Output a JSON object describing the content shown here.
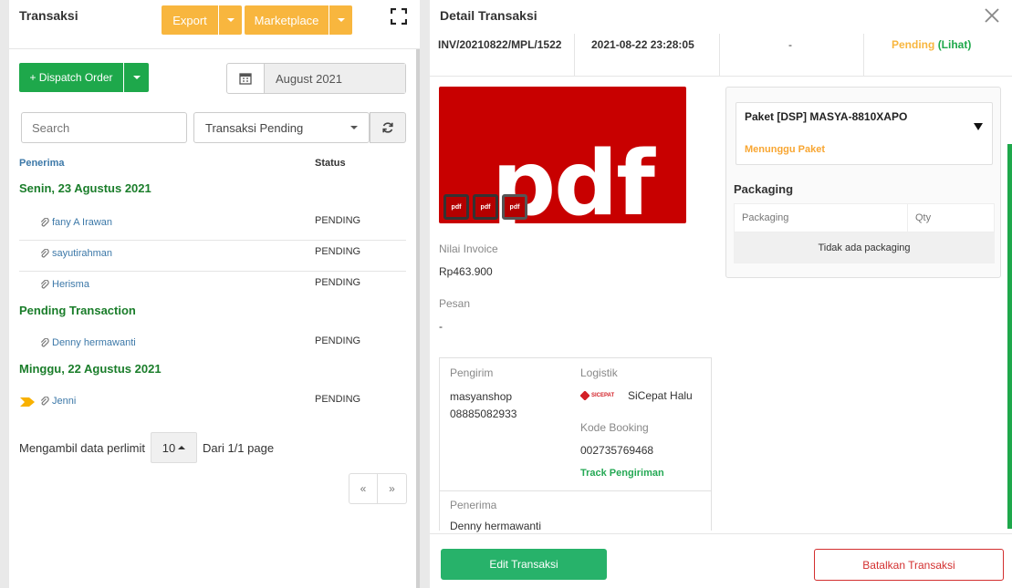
{
  "left": {
    "title": "Transaksi",
    "export_label": "Export",
    "marketplace_label": "Marketplace",
    "dispatch_label": "+ Dispatch Order",
    "month": "August 2021",
    "search_placeholder": "Search",
    "filter_selected": "Transaksi Pending",
    "col_receiver": "Penerima",
    "col_status": "Status",
    "groups": [
      {
        "title": "Senin, 23 Agustus 2021",
        "rows": [
          {
            "name": "fany A Irawan",
            "status": "PENDING"
          },
          {
            "name": "sayutirahman",
            "status": "PENDING"
          },
          {
            "name": "Herisma",
            "status": "PENDING"
          }
        ]
      },
      {
        "title": "Pending Transaction",
        "rows": [
          {
            "name": "Denny hermawanti",
            "status": "PENDING"
          }
        ]
      },
      {
        "title": "Minggu, 22 Agustus 2021",
        "rows": [
          {
            "name": "Jenni",
            "status": "PENDING"
          }
        ]
      }
    ],
    "limit_prefix": "Mengambil data perlimit",
    "limit_value": "10",
    "limit_suffix": "Dari 1/1 page",
    "pager_prev": "«",
    "pager_next": "»"
  },
  "detail": {
    "title": "Detail Transaksi",
    "summary": {
      "invoice": "INV/20210822/MPL/1522",
      "datetime": "2021-08-22 23:28:05",
      "dash": "-",
      "status": "Pending",
      "status_link": "(Lihat)"
    },
    "pdf_text": "pdf",
    "mini_label": "pdf",
    "nilai_label": "Nilai Invoice",
    "nilai_value": "Rp463.900",
    "pesan_label": "Pesan",
    "pesan_value": "-",
    "pengirim_label": "Pengirim",
    "pengirim_name": "masyanshop",
    "pengirim_phone": "08885082933",
    "logistik_label": "Logistik",
    "logistik_value": "SiCepat Halu",
    "logistik_logo_text": "SICEPAT",
    "kode_label": "Kode Booking",
    "kode_value": "002735769468",
    "track_label": "Track Pengiriman",
    "penerima_label": "Penerima",
    "penerima_value": "Denny hermawanti",
    "package": {
      "name": "Paket [DSP] MASYA-8810XAPO",
      "status": "Menunggu Paket"
    },
    "packaging_title": "Packaging",
    "packaging_col1": "Packaging",
    "packaging_col2": "Qty",
    "packaging_empty": "Tidak ada packaging",
    "edit_label": "Edit Transaksi",
    "cancel_label": "Batalkan Transaksi"
  },
  "colors": {
    "green": "#1ea84b",
    "orange": "#f8b63e",
    "pending": "#f8b63e",
    "danger": "#d32f2f"
  }
}
